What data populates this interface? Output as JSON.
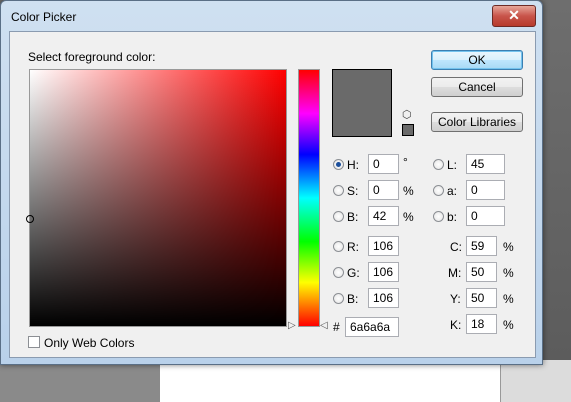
{
  "window": {
    "title": "Color Picker",
    "close_label": "✕"
  },
  "prompt": "Select foreground color:",
  "buttons": {
    "ok": "OK",
    "cancel": "Cancel",
    "libraries": "Color Libraries"
  },
  "hsb": {
    "h": {
      "label": "H:",
      "value": "0",
      "unit": "°"
    },
    "s": {
      "label": "S:",
      "value": "0",
      "unit": "%"
    },
    "b": {
      "label": "B:",
      "value": "42",
      "unit": "%"
    }
  },
  "rgb": {
    "r": {
      "label": "R:",
      "value": "106"
    },
    "g": {
      "label": "G:",
      "value": "106"
    },
    "b": {
      "label": "B:",
      "value": "106"
    }
  },
  "lab": {
    "l": {
      "label": "L:",
      "value": "45"
    },
    "a": {
      "label": "a:",
      "value": "0"
    },
    "b": {
      "label": "b:",
      "value": "0"
    }
  },
  "cmyk": {
    "c": {
      "label": "C:",
      "value": "59",
      "unit": "%"
    },
    "m": {
      "label": "M:",
      "value": "50",
      "unit": "%"
    },
    "y": {
      "label": "Y:",
      "value": "50",
      "unit": "%"
    },
    "k": {
      "label": "K:",
      "value": "18",
      "unit": "%"
    }
  },
  "hex": {
    "label": "#",
    "value": "6a6a6a"
  },
  "only_web_colors": "Only Web Colors",
  "current_color": "#6a6a6a"
}
